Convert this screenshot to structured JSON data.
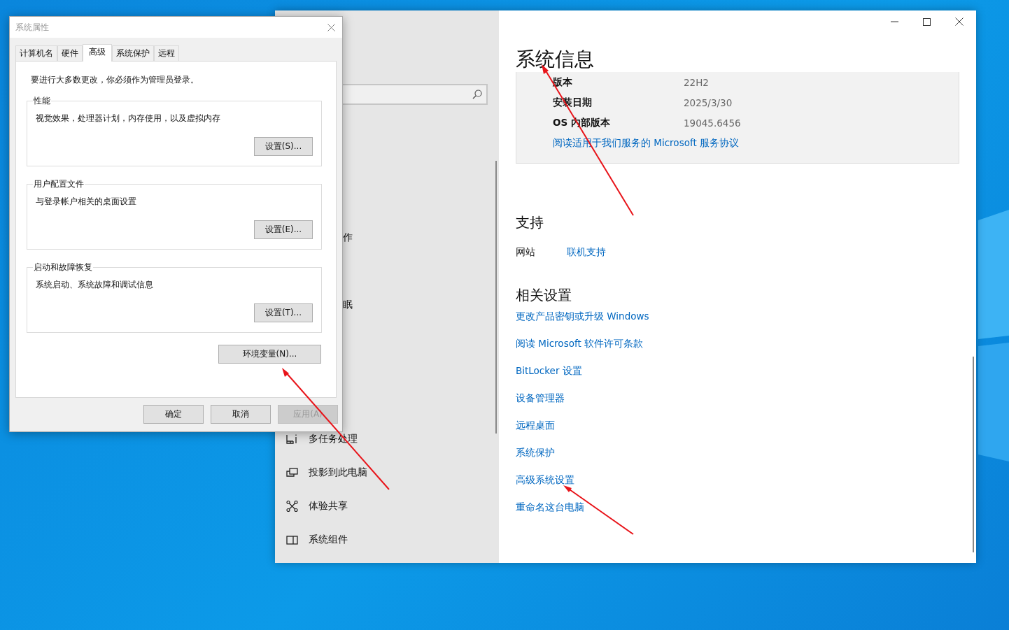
{
  "settings_window": {
    "nav_items": [
      {
        "kind": "clipped",
        "label": "作"
      },
      {
        "kind": "hidden"
      },
      {
        "kind": "clipped",
        "label": "眠"
      },
      {
        "kind": "hidden"
      },
      {
        "kind": "hidden"
      },
      {
        "kind": "hidden"
      },
      {
        "kind": "multitask",
        "label": "多任务处理"
      },
      {
        "kind": "project",
        "label": "投影到此电脑"
      },
      {
        "kind": "share",
        "label": "体验共享"
      },
      {
        "kind": "components",
        "label": "系统组件"
      }
    ],
    "system_info": {
      "title": "系统信息",
      "rows": [
        {
          "label": "版本",
          "value": "22H2"
        },
        {
          "label": "安装日期",
          "value": "2025/3/30"
        },
        {
          "label": "OS 内部版本",
          "value": "19045.6456"
        }
      ],
      "link": "阅读适用于我们服务的 Microsoft 服务协议"
    },
    "support": {
      "title": "支持",
      "rows": [
        {
          "label": "网站",
          "link": "联机支持"
        }
      ]
    },
    "related_settings": {
      "title": "相关设置",
      "links": [
        "更改产品密钥或升级 Windows",
        "阅读 Microsoft 软件许可条款",
        "BitLocker 设置",
        "设备管理器",
        "远程桌面",
        "系统保护",
        "高级系统设置",
        "重命名这台电脑"
      ]
    }
  },
  "dialog": {
    "title": "系统属性",
    "tabs": [
      {
        "label": "计算机名",
        "selected": false
      },
      {
        "label": "硬件",
        "selected": false
      },
      {
        "label": "高级",
        "selected": true
      },
      {
        "label": "系统保护",
        "selected": false
      },
      {
        "label": "远程",
        "selected": false
      }
    ],
    "notice": "要进行大多数更改，你必须作为管理员登录。",
    "groups": [
      {
        "title": "性能",
        "description": "视觉效果，处理器计划，内存使用，以及虚拟内存",
        "button": "设置(S)..."
      },
      {
        "title": "用户配置文件",
        "description": "与登录帐户相关的桌面设置",
        "button": "设置(E)..."
      },
      {
        "title": "启动和故障恢复",
        "description": "系统启动、系统故障和调试信息",
        "button": "设置(T)..."
      }
    ],
    "env_button": "环境变量(N)...",
    "buttons": [
      {
        "label": "确定",
        "disabled": false
      },
      {
        "label": "取消",
        "disabled": false
      },
      {
        "label": "应用(A)",
        "disabled": true
      }
    ]
  }
}
